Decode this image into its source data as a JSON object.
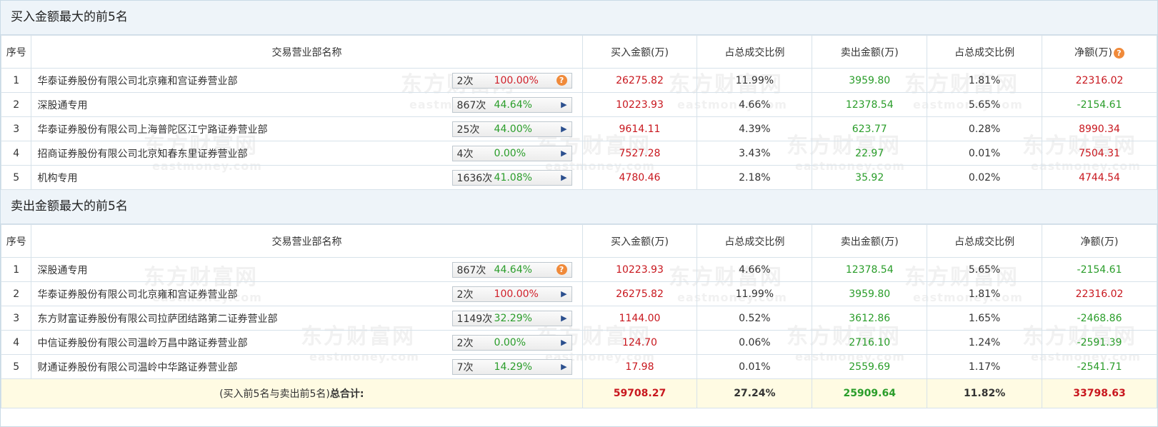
{
  "headers": {
    "seq": "序号",
    "name": "交易营业部名称",
    "buy_amount": "买入金额(万)",
    "buy_ratio": "占总成交比例",
    "sell_amount": "卖出金额(万)",
    "sell_ratio": "占总成交比例",
    "net": "净额(万)"
  },
  "watermark": {
    "cn": "东方财富网",
    "en": "eastmoney.com"
  },
  "buy_section": {
    "title": "买入金额最大的前5名",
    "rows": [
      {
        "seq": "1",
        "name": "华泰证券股份有限公司北京雍和宫证券营业部",
        "count": "2次",
        "pct": "100.00%",
        "buy": "26275.82",
        "buy_ratio": "11.99%",
        "sell": "3959.80",
        "sell_ratio": "1.81%",
        "net": "22316.02"
      },
      {
        "seq": "2",
        "name": "深股通专用",
        "count": "867次",
        "pct": "44.64%",
        "buy": "10223.93",
        "buy_ratio": "4.66%",
        "sell": "12378.54",
        "sell_ratio": "5.65%",
        "net": "-2154.61"
      },
      {
        "seq": "3",
        "name": "华泰证券股份有限公司上海普陀区江宁路证券营业部",
        "count": "25次",
        "pct": "44.00%",
        "buy": "9614.11",
        "buy_ratio": "4.39%",
        "sell": "623.77",
        "sell_ratio": "0.28%",
        "net": "8990.34"
      },
      {
        "seq": "4",
        "name": "招商证券股份有限公司北京知春东里证券营业部",
        "count": "4次",
        "pct": "0.00%",
        "buy": "7527.28",
        "buy_ratio": "3.43%",
        "sell": "22.97",
        "sell_ratio": "0.01%",
        "net": "7504.31"
      },
      {
        "seq": "5",
        "name": "机构专用",
        "count": "1636次",
        "pct": "41.08%",
        "buy": "4780.46",
        "buy_ratio": "2.18%",
        "sell": "35.92",
        "sell_ratio": "0.02%",
        "net": "4744.54"
      }
    ]
  },
  "sell_section": {
    "title": "卖出金额最大的前5名",
    "rows": [
      {
        "seq": "1",
        "name": "深股通专用",
        "count": "867次",
        "pct": "44.64%",
        "buy": "10223.93",
        "buy_ratio": "4.66%",
        "sell": "12378.54",
        "sell_ratio": "5.65%",
        "net": "-2154.61"
      },
      {
        "seq": "2",
        "name": "华泰证券股份有限公司北京雍和宫证券营业部",
        "count": "2次",
        "pct": "100.00%",
        "buy": "26275.82",
        "buy_ratio": "11.99%",
        "sell": "3959.80",
        "sell_ratio": "1.81%",
        "net": "22316.02"
      },
      {
        "seq": "3",
        "name": "东方财富证券股份有限公司拉萨团结路第二证券营业部",
        "count": "1149次",
        "pct": "32.29%",
        "buy": "1144.00",
        "buy_ratio": "0.52%",
        "sell": "3612.86",
        "sell_ratio": "1.65%",
        "net": "-2468.86"
      },
      {
        "seq": "4",
        "name": "中信证券股份有限公司温岭万昌中路证券营业部",
        "count": "2次",
        "pct": "0.00%",
        "buy": "124.70",
        "buy_ratio": "0.06%",
        "sell": "2716.10",
        "sell_ratio": "1.24%",
        "net": "-2591.39"
      },
      {
        "seq": "5",
        "name": "财通证券股份有限公司温岭中华路证券营业部",
        "count": "7次",
        "pct": "14.29%",
        "buy": "17.98",
        "buy_ratio": "0.01%",
        "sell": "2559.69",
        "sell_ratio": "1.17%",
        "net": "-2541.71"
      }
    ]
  },
  "total": {
    "label_prefix": "(买入前5名与卖出前5名)",
    "label_bold": "总合计:",
    "buy": "59708.27",
    "buy_ratio": "27.24%",
    "sell": "25909.64",
    "sell_ratio": "11.82%",
    "net": "33798.63"
  },
  "colors": {
    "red": "#c8171e",
    "green": "#2a9d2a",
    "header_bg": "#eef4f9",
    "total_bg": "#fffbe3",
    "qmark": "#f08a3a"
  }
}
